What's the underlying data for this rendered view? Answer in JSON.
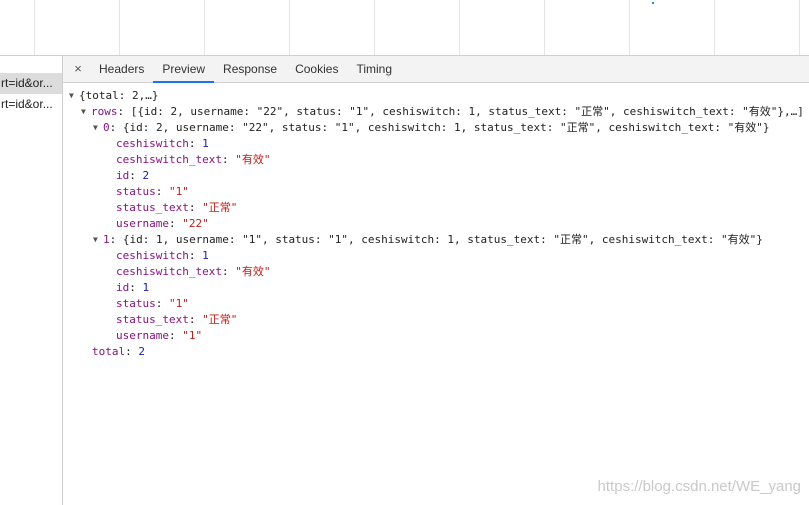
{
  "tabs": {
    "close": "×",
    "items": [
      "Headers",
      "Preview",
      "Response",
      "Cookies",
      "Timing"
    ],
    "active_index": 1
  },
  "requests": [
    "rt=id&or...",
    "rt=id&or..."
  ],
  "tree": {
    "root_summary": "{total: 2,…}",
    "rows_key": "rows",
    "rows_summary": "[{id: 2, username: \"22\", status: \"1\", ceshiswitch: 1, status_text: \"正常\", ceshiswitch_text: \"有效\"},…]",
    "items": [
      {
        "index": "0",
        "summary": "{id: 2, username: \"22\", status: \"1\", ceshiswitch: 1, status_text: \"正常\", ceshiswitch_text: \"有效\"}",
        "fields": [
          {
            "key": "ceshiswitch",
            "value": "1",
            "type": "num"
          },
          {
            "key": "ceshiswitch_text",
            "value": "\"有效\"",
            "type": "str"
          },
          {
            "key": "id",
            "value": "2",
            "type": "num"
          },
          {
            "key": "status",
            "value": "\"1\"",
            "type": "str"
          },
          {
            "key": "status_text",
            "value": "\"正常\"",
            "type": "str"
          },
          {
            "key": "username",
            "value": "\"22\"",
            "type": "str"
          }
        ]
      },
      {
        "index": "1",
        "summary": "{id: 1, username: \"1\", status: \"1\", ceshiswitch: 1, status_text: \"正常\", ceshiswitch_text: \"有效\"}",
        "fields": [
          {
            "key": "ceshiswitch",
            "value": "1",
            "type": "num"
          },
          {
            "key": "ceshiswitch_text",
            "value": "\"有效\"",
            "type": "str"
          },
          {
            "key": "id",
            "value": "1",
            "type": "num"
          },
          {
            "key": "status",
            "value": "\"1\"",
            "type": "str"
          },
          {
            "key": "status_text",
            "value": "\"正常\"",
            "type": "str"
          },
          {
            "key": "username",
            "value": "\"1\"",
            "type": "str"
          }
        ]
      }
    ],
    "total_key": "total",
    "total_value": "2"
  },
  "watermark": "https://blog.csdn.net/WE_yang",
  "colors": {
    "accent": "#1a73e8",
    "key": "#881280",
    "number": "#1a1aa6",
    "string": "#c41a16"
  }
}
